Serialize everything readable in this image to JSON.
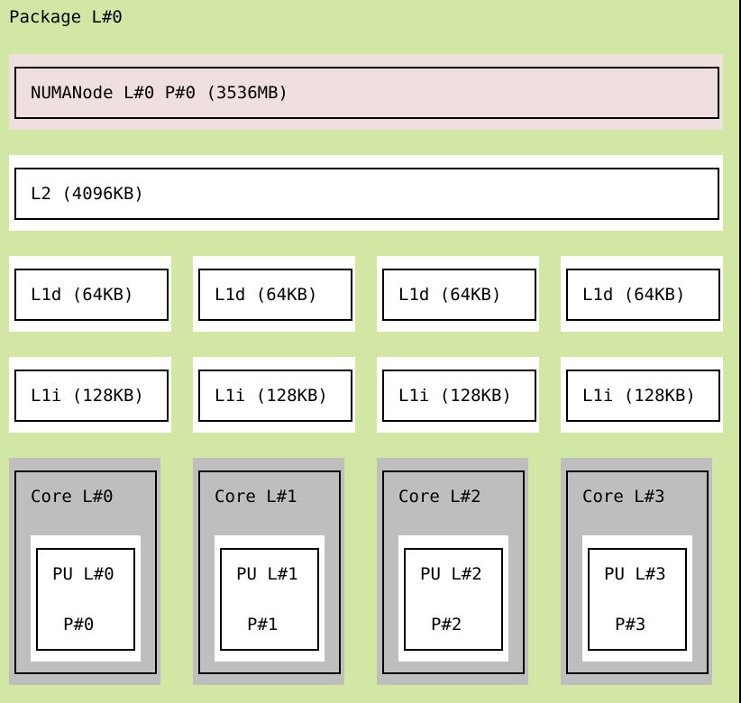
{
  "package": {
    "label": "Package L#0"
  },
  "numa": {
    "label": "NUMANode L#0 P#0 (3536MB)"
  },
  "l2": {
    "label": "L2 (4096KB)"
  },
  "l1d": [
    "L1d (64KB)",
    "L1d (64KB)",
    "L1d (64KB)",
    "L1d (64KB)"
  ],
  "l1i": [
    "L1i (128KB)",
    "L1i (128KB)",
    "L1i (128KB)",
    "L1i (128KB)"
  ],
  "cores": [
    {
      "label": "Core L#0",
      "pu_label": "PU L#0",
      "pu_os": "P#0"
    },
    {
      "label": "Core L#1",
      "pu_label": "PU L#1",
      "pu_os": "P#1"
    },
    {
      "label": "Core L#2",
      "pu_label": "PU L#2",
      "pu_os": "P#2"
    },
    {
      "label": "Core L#3",
      "pu_label": "PU L#3",
      "pu_os": "P#3"
    }
  ],
  "colors": {
    "package": "#d2e7a4",
    "numa": "#efdfde",
    "cache": "#ffffff",
    "core": "#bebebe",
    "pu": "#ffffff"
  }
}
